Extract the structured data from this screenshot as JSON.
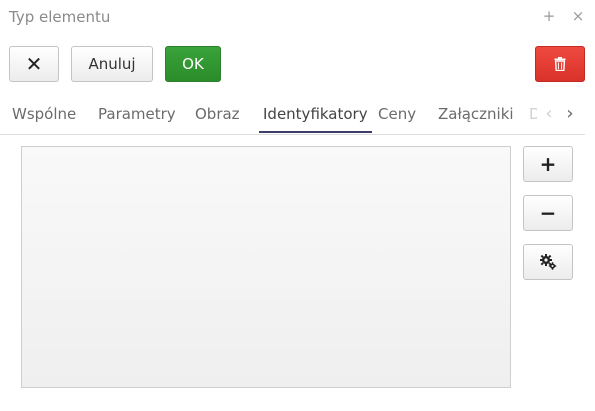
{
  "window": {
    "title": "Typ elementu",
    "expand_glyph": "+",
    "close_glyph": "×"
  },
  "toolbar": {
    "close_glyph": "✕",
    "cancel_label": "Anuluj",
    "ok_label": "OK",
    "delete_icon": "trash-icon"
  },
  "tabs": [
    {
      "label": "Wspólne"
    },
    {
      "label": "Parametry"
    },
    {
      "label": "Obraz"
    },
    {
      "label": "Identyfikatory",
      "active": true
    },
    {
      "label": "Ceny"
    },
    {
      "label": "Załączniki"
    },
    {
      "label": "D"
    }
  ],
  "tab_nav": {
    "prev_glyph": "‹",
    "next_glyph": "›"
  },
  "side_buttons": {
    "add_glyph": "+",
    "remove_glyph": "−",
    "settings_icon": "gears-icon"
  },
  "colors": {
    "ok": "#2f962f",
    "delete": "#e53a32",
    "active_tab_underline": "#3e3e6a"
  }
}
